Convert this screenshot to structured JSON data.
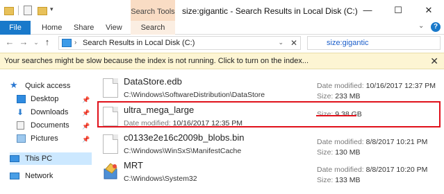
{
  "window": {
    "title": "size:gigantic - Search Results in Local Disk (C:)",
    "context_tab": "Search Tools",
    "controls": {
      "minimize": "—",
      "maximize": "☐",
      "close": "✕"
    }
  },
  "ribbon": {
    "tabs": [
      "File",
      "Home",
      "Share",
      "View",
      "Search"
    ],
    "help": "?"
  },
  "address": {
    "path": "Search Results in Local Disk (C:)",
    "search_query": "size:gigantic"
  },
  "infobar": {
    "message": "Your searches might be slow because the index is not running.  Click to turn on the index...",
    "close": "✕"
  },
  "sidebar": {
    "quick_access": "Quick access",
    "pinned": [
      "Desktop",
      "Downloads",
      "Documents",
      "Pictures"
    ],
    "this_pc": "This PC",
    "network": "Network"
  },
  "results": [
    {
      "name": "DataStore.edb",
      "path": "C:\\Windows\\SoftwareDistribution\\DataStore",
      "date_label": "Date modified:",
      "date": "10/16/2017 12:37 PM",
      "size_label": "Size:",
      "size": "233 MB"
    },
    {
      "name": "ultra_mega_large",
      "date_label": "Date modified:",
      "date": "10/16/2017 12:35 PM",
      "size_label": "Size:",
      "size": "9.38 GB"
    },
    {
      "name": "c0133e2e16c2009b_blobs.bin",
      "path": "C:\\Windows\\WinSxS\\ManifestCache",
      "date_label": "Date modified:",
      "date": "8/8/2017 10:21 PM",
      "size_label": "Size:",
      "size": "130 MB"
    },
    {
      "name": "MRT",
      "path": "C:\\Windows\\System32",
      "date_label": "Date modified:",
      "date": "8/8/2017 10:20 PM",
      "size_label": "Size:",
      "size": "133 MB"
    }
  ],
  "colors": {
    "accent": "#1979ca",
    "highlight": "#e0101a",
    "infobar": "#fdf5d3",
    "context_tab": "#f9dcc4"
  }
}
